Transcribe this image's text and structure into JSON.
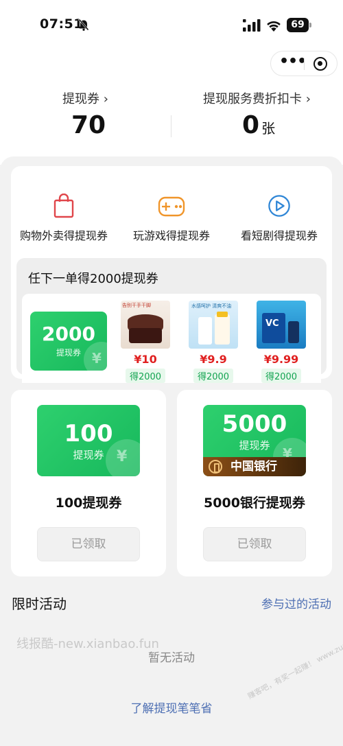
{
  "status_bar": {
    "time": "07:51",
    "battery": "69"
  },
  "summary": {
    "coupon_label": "提现券 ›",
    "coupon_value": "70",
    "fee_card_label": "提现服务费折扣卡 ›",
    "fee_card_value": "0",
    "fee_card_unit": "张"
  },
  "tasks": [
    {
      "label": "购物外卖得提现券",
      "icon": "shopping-bag-icon",
      "color": "#e0454a"
    },
    {
      "label": "玩游戏得提现券",
      "icon": "gamepad-icon",
      "color": "#f0952a"
    },
    {
      "label": "看短剧得提现券",
      "icon": "play-circle-icon",
      "color": "#2f86d6"
    }
  ],
  "order_offer": {
    "title": "任下一单得2000提现券",
    "coupon_amount": "2000",
    "coupon_label": "提现券",
    "products": [
      {
        "price": "¥10",
        "reward": "得2000",
        "image_text": "告别干手干脚"
      },
      {
        "price": "¥9.9",
        "reward": "得2000",
        "image_text": "水感呵护 清爽不油"
      },
      {
        "price": "¥9.99",
        "reward": "得2000",
        "image_text": "VC"
      }
    ]
  },
  "coupon_cards": [
    {
      "amount": "100",
      "label": "提现券",
      "title": "100提现券",
      "button": "已领取"
    },
    {
      "amount": "5000",
      "label": "提现券",
      "bank": "中国银行",
      "title": "5000银行提现券",
      "button": "已领取"
    }
  ],
  "limited": {
    "title": "限时活动",
    "link": "参与过的活动",
    "empty": "暂无活动"
  },
  "watermarks": {
    "site": "线报酷-new.xianbao.fun",
    "corner": "赚客吧，有奖一起赚！ www.zuanke8.com"
  },
  "footer_link": "了解提现笔笔省",
  "colors": {
    "green": "#1fc463",
    "price_red": "#e02020",
    "link_blue": "#4d6fb3"
  }
}
